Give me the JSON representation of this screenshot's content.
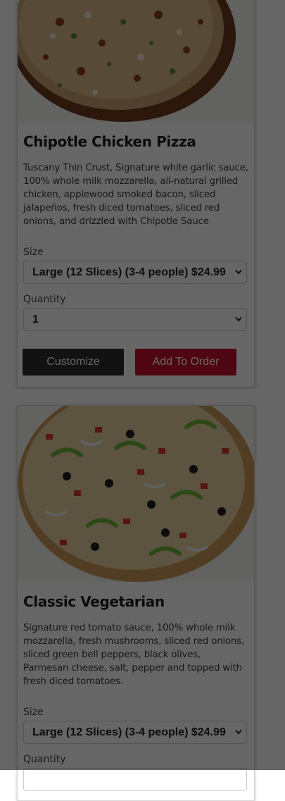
{
  "products": [
    {
      "name": "Chipotle Chicken Pizza",
      "description": "Tuscany Thin Crust, Signature white garlic sauce, 100% whole milk mozzarella, all-natural grilled chicken, applewood smoked bacon, sliced jalapeños, fresh diced tomatoes, sliced red onions, and drizzled with Chipotle Sauce",
      "size_label": "Size",
      "size_value": "Large (12 Slices) (3-4 people) $24.99",
      "quantity_label": "Quantity",
      "quantity_value": "1",
      "customize_label": "Customize",
      "add_label": "Add To Order"
    },
    {
      "name": "Classic Vegetarian",
      "description": "Signature red tomato sauce, 100% whole milk mozzarella, fresh mushrooms, sliced red onions, sliced green bell peppers, black olives, Parmesan cheese, salt, pepper and topped with fresh diced tomatoes.",
      "size_label": "Size",
      "size_value": "Large (12 Slices) (3-4 people) $24.99",
      "quantity_label": "Quantity"
    }
  ],
  "colors": {
    "add_button": "#c8102e",
    "customize_button": "#2e2e2e",
    "overlay": "rgba(0,0,0,0.6)"
  },
  "icons": [
    "chevron-down-icon"
  ]
}
